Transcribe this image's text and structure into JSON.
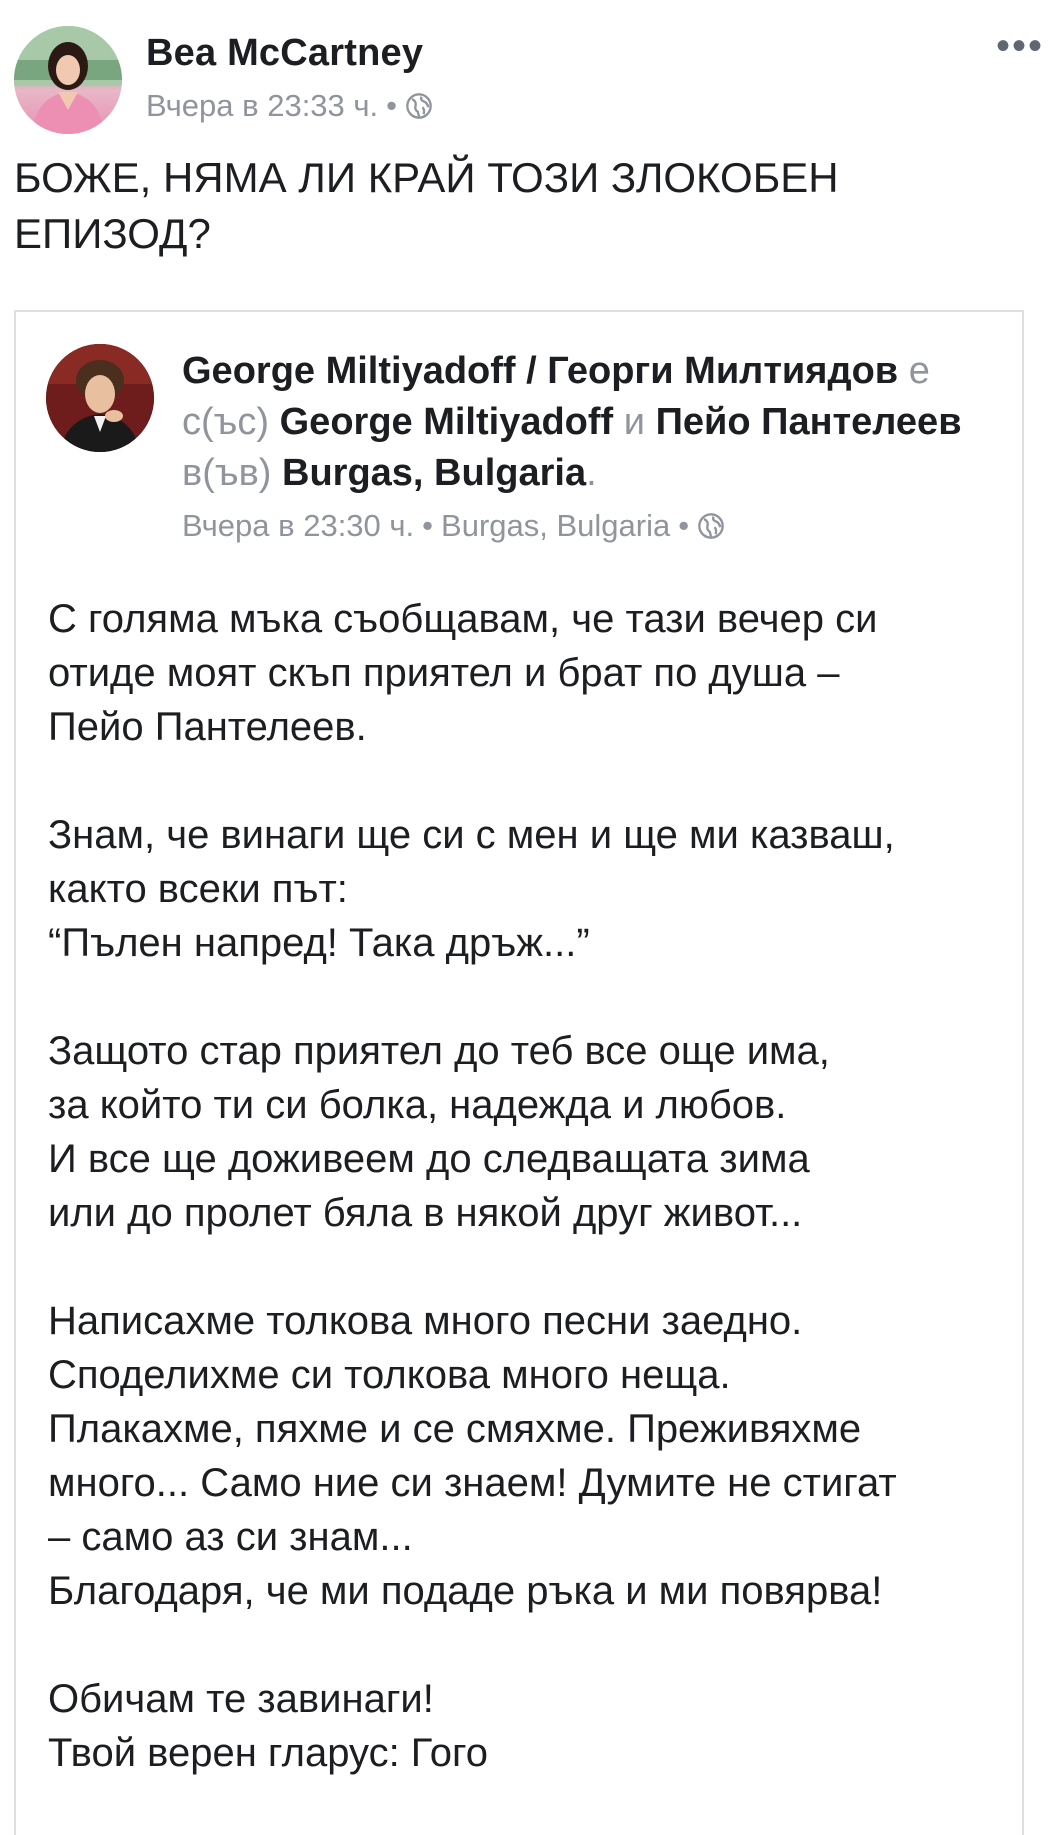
{
  "post": {
    "author": "Bea McCartney",
    "timestamp": "Вчера в 23:33 ч.",
    "separator": "•",
    "privacy_icon": "globe-icon",
    "more_icon": "•••",
    "caption_lines": [
      "БОЖЕ, НЯМА ЛИ КРАЙ ТОЗИ ЗЛОКОБЕН",
      "ЕПИЗОД?"
    ]
  },
  "shared": {
    "author": "George Miltiyadoff / Георги Милтиядов",
    "with_text": "е с(ъс)",
    "tag1": "George Miltiyadoff",
    "and_text": "и",
    "tag2": "Пейо Пантелеев",
    "in_text": "в(ъв)",
    "location": "Burgas, Bulgaria",
    "period": ".",
    "timestamp": "Вчера в 23:30 ч.",
    "separator": "•",
    "meta_location": "Burgas, Bulgaria",
    "privacy_icon": "globe-icon",
    "paragraphs": [
      [
        "С голяма мъка съобщавам, че тази вечер си",
        "отиде моят скъп приятел и брат по душа –",
        "Пейо Пантелеев."
      ],
      [
        "Знам, че винаги ще си с мен и ще ми казваш,",
        "както всеки път:",
        "“Пълен напред! Така дръж...”"
      ],
      [
        "Защото стар приятел до теб все още има,",
        "за който ти си болка, надежда и любов.",
        "И все ще доживеем до следващата зима",
        "или до пролет бяла в някой друг живот..."
      ],
      [
        "Написахме толкова много песни заедно.",
        "Споделихме си толкова много неща.",
        "Плакахме, пяхме и се смяхме. Преживяхме",
        "много... Само ние си знаем! Думите не стигат",
        "– само аз си знам...",
        "Благодаря, че ми подаде ръка и ми повярва!"
      ],
      [
        "Обичам те завинаги!",
        "Твой верен гларус: Гого"
      ]
    ]
  }
}
